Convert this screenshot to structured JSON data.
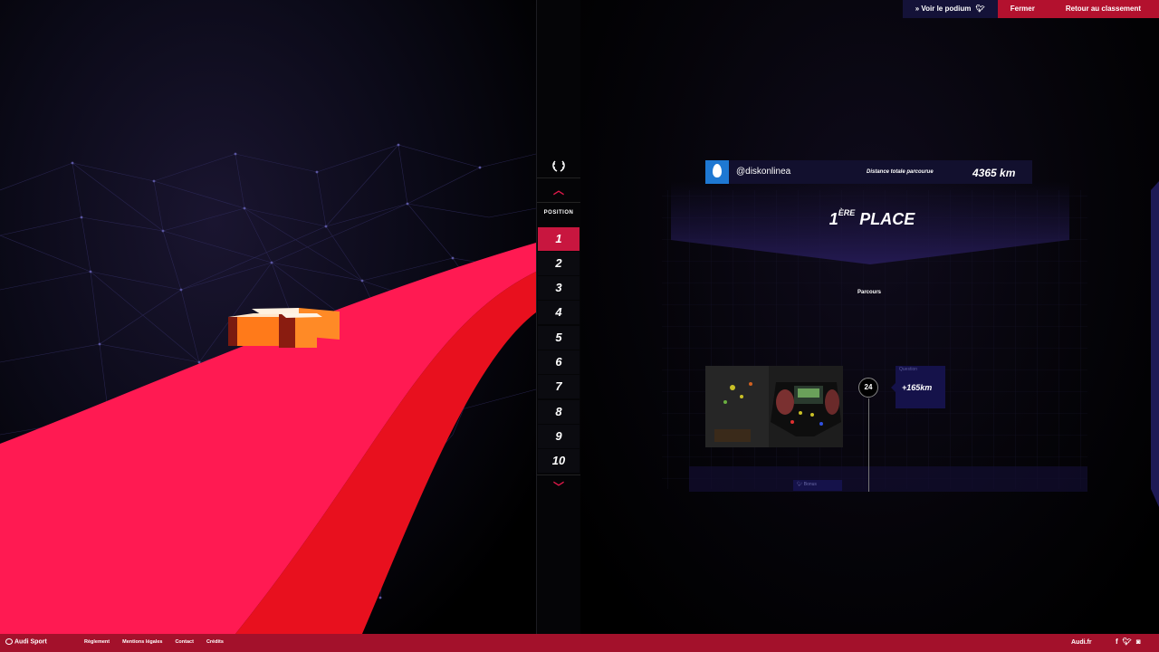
{
  "header": {
    "podium_label": "» Voir le podium",
    "podium_icon": "twitter-icon",
    "close_label": "Fermer",
    "back_label": "Retour au classement"
  },
  "rail": {
    "position_label": "POSITION",
    "positions": [
      "1",
      "2",
      "3",
      "4",
      "5",
      "6",
      "7",
      "8",
      "9",
      "10"
    ],
    "active_position": "1",
    "up_icon": "chevron-up-icon",
    "down_icon": "chevron-down-icon",
    "laurel_icon": "laurel-icon"
  },
  "profile": {
    "username": "@diskonlinea",
    "distance_label": "Distance totale parcourue",
    "distance_value": "4365 km",
    "avatar_icon": "egg-avatar-icon"
  },
  "rank": {
    "number": "1",
    "suffix": "ÈRE",
    "label": "PLACE"
  },
  "route": {
    "title": "Parcours",
    "marker": "24",
    "question_label": "Question",
    "question_value": "+165km",
    "bonus_label": "Bonus"
  },
  "footer": {
    "brand": "Audi Sport",
    "links": [
      "Règlement",
      "Mentions légales",
      "Contact",
      "Crédits"
    ],
    "site": "Audi.fr",
    "social_icons": [
      "facebook-icon",
      "twitter-icon",
      "instagram-icon"
    ]
  },
  "colors": {
    "accent": "#c8163f",
    "track": "#ff1a4f",
    "navy": "#141238"
  }
}
